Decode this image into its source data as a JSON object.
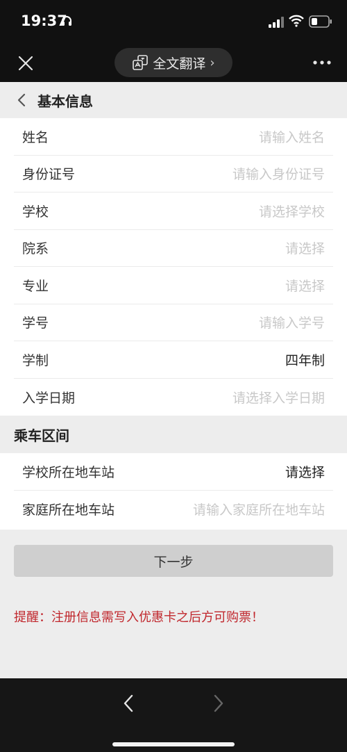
{
  "status_bar": {
    "time": "19:37"
  },
  "nav": {
    "translate_label": "全文翻译",
    "translate_chevron": "›"
  },
  "basic_info": {
    "title": "基本信息",
    "rows": [
      {
        "label": "姓名",
        "value": "请输入姓名",
        "filled": false
      },
      {
        "label": "身份证号",
        "value": "请输入身份证号",
        "filled": false
      },
      {
        "label": "学校",
        "value": "请选择学校",
        "filled": false
      },
      {
        "label": "院系",
        "value": "请选择",
        "filled": false
      },
      {
        "label": "专业",
        "value": "请选择",
        "filled": false
      },
      {
        "label": "学号",
        "value": "请输入学号",
        "filled": false
      },
      {
        "label": "学制",
        "value": "四年制",
        "filled": true
      },
      {
        "label": "入学日期",
        "value": "请选择入学日期",
        "filled": false
      }
    ]
  },
  "ride_section": {
    "title": "乘车区间",
    "rows": [
      {
        "label": "学校所在地车站",
        "value": "请选择",
        "filled": true
      },
      {
        "label": "家庭所在地车站",
        "value": "请输入家庭所在地车站",
        "filled": false
      }
    ]
  },
  "next_button": "下一步",
  "reminder": "提醒：注册信息需写入优惠卡之后方可购票！",
  "colors": {
    "reminder": "#c0262c",
    "bar": "#111111",
    "button": "#cfcfcf"
  }
}
